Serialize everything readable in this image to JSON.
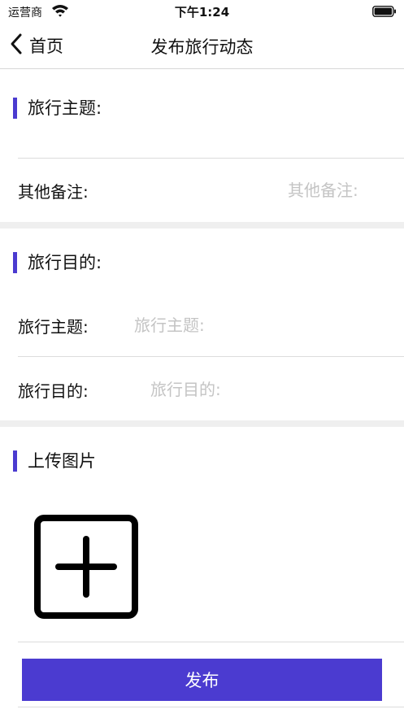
{
  "status_bar": {
    "carrier": "运营商",
    "time": "下午1:24",
    "wifi_icon": "wifi-icon",
    "battery_icon": "battery-icon"
  },
  "nav": {
    "back_label": "首页",
    "title": "发布旅行动态",
    "back_icon": "chevron-left-icon"
  },
  "section1": {
    "title": "旅行主题:",
    "remarks": {
      "label": "其他备注:",
      "value": "",
      "placeholder": "其他备注:"
    }
  },
  "section2": {
    "title": "旅行目的:",
    "theme": {
      "label": "旅行主题:",
      "value": "",
      "placeholder": "旅行主题:"
    },
    "purpose": {
      "label": "旅行目的:",
      "value": "",
      "placeholder": "旅行目的:"
    }
  },
  "section3": {
    "title": "上传图片",
    "add_icon": "add-square-icon"
  },
  "publish": {
    "label": "发布"
  },
  "colors": {
    "accent": "#4b3bd0",
    "separator": "#efefef",
    "placeholder": "#c4c4c4"
  }
}
